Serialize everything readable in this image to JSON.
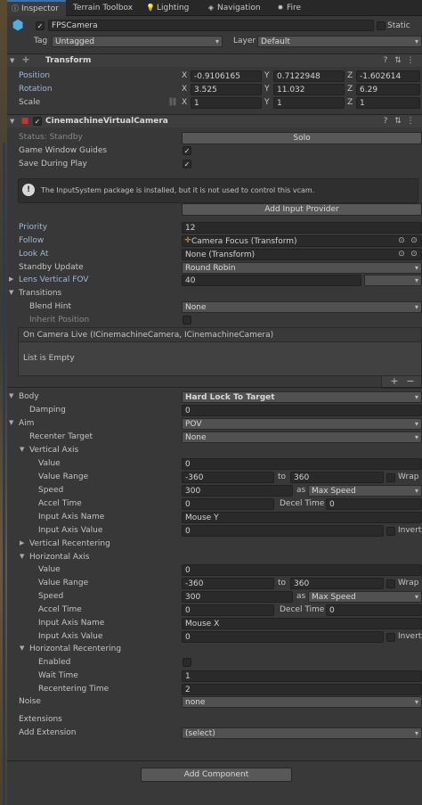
{
  "tabs": [
    {
      "icon": "info-icon",
      "label": "Inspector"
    },
    {
      "icon": "",
      "label": "Terrain Toolbox"
    },
    {
      "icon": "bulb-icon",
      "label": "Lighting"
    },
    {
      "icon": "navigation-icon",
      "label": "Navigation"
    },
    {
      "icon": "fire-icon",
      "label": "Fire"
    }
  ],
  "object": {
    "name": "FPSCamera",
    "static_label": "Static",
    "tag_label": "Tag",
    "tag_value": "Untagged",
    "layer_label": "Layer",
    "layer_value": "Default"
  },
  "transform": {
    "title": "Transform",
    "position_label": "Position",
    "rotation_label": "Rotation",
    "scale_label": "Scale",
    "axes": [
      "X",
      "Y",
      "Z"
    ],
    "position": [
      "-0.9106165",
      "0.7122948",
      "-1.602614"
    ],
    "rotation": [
      "3.525",
      "11.032",
      "6.29"
    ],
    "scale": [
      "1",
      "1",
      "1"
    ]
  },
  "vcam": {
    "title": "CinemachineVirtualCamera",
    "status_label": "Status: Standby",
    "solo_label": "Solo",
    "game_window_guides_label": "Game Window Guides",
    "save_during_play_label": "Save During Play",
    "info_text": "The InputSystem package is installed, but it is not used to control this vcam.",
    "add_input_provider_label": "Add Input Provider",
    "priority_label": "Priority",
    "priority_value": "12",
    "follow_label": "Follow",
    "follow_value": "Camera Focus (Transform)",
    "lookat_label": "Look At",
    "lookat_value": "None (Transform)",
    "standby_label": "Standby Update",
    "standby_value": "Round Robin",
    "lens_label": "Lens Vertical FOV",
    "lens_value": "40",
    "transitions_label": "Transitions",
    "blend_hint_label": "Blend Hint",
    "blend_hint_value": "None",
    "inherit_position_label": "Inherit Position",
    "on_camera_live_label": "On Camera Live (ICinemachineCamera, ICinemachineCamera)",
    "list_empty_label": "List is Empty",
    "plus": "+",
    "minus": "−",
    "body_label": "Body",
    "body_value": "Hard Lock To Target",
    "damping_label": "Damping",
    "damping_value": "0",
    "aim_label": "Aim",
    "aim_value": "POV",
    "recenter_target_label": "Recenter Target",
    "recenter_target_value": "None",
    "vertical_axis_label": "Vertical Axis",
    "horizontal_axis_label": "Horizontal Axis",
    "value_label": "Value",
    "value_range_label": "Value Range",
    "to_label": "to",
    "wrap_label": "Wrap",
    "speed_label": "Speed",
    "as_label": "as",
    "accel_label": "Accel Time",
    "decel_label": "Decel Time",
    "input_axis_name_label": "Input Axis Name",
    "input_axis_value_label": "Input Axis Value",
    "invert_label": "Invert",
    "vertical": {
      "value": "0",
      "range_min": "-360",
      "range_max": "360",
      "speed": "300",
      "speed_mode": "Max Speed",
      "accel": "0",
      "decel": "0",
      "axis_name": "Mouse Y",
      "axis_value": "0"
    },
    "vertical_recentering_label": "Vertical Recentering",
    "horizontal": {
      "value": "0",
      "range_min": "-360",
      "range_max": "360",
      "speed": "300",
      "speed_mode": "Max Speed",
      "accel": "0",
      "decel": "0",
      "axis_name": "Mouse X",
      "axis_value": "0"
    },
    "horizontal_recentering_label": "Horizontal Recentering",
    "enabled_label": "Enabled",
    "wait_time_label": "Wait Time",
    "wait_time_value": "1",
    "recentering_time_label": "Recentering Time",
    "recentering_time_value": "2",
    "noise_label": "Noise",
    "noise_value": "none",
    "extensions_label": "Extensions",
    "add_extension_label": "Add Extension",
    "add_extension_value": "(select)"
  },
  "add_component_label": "Add Component",
  "colors": {
    "accent": "#3a72b0",
    "panel": "#383838",
    "field": "#2a2a2a"
  }
}
